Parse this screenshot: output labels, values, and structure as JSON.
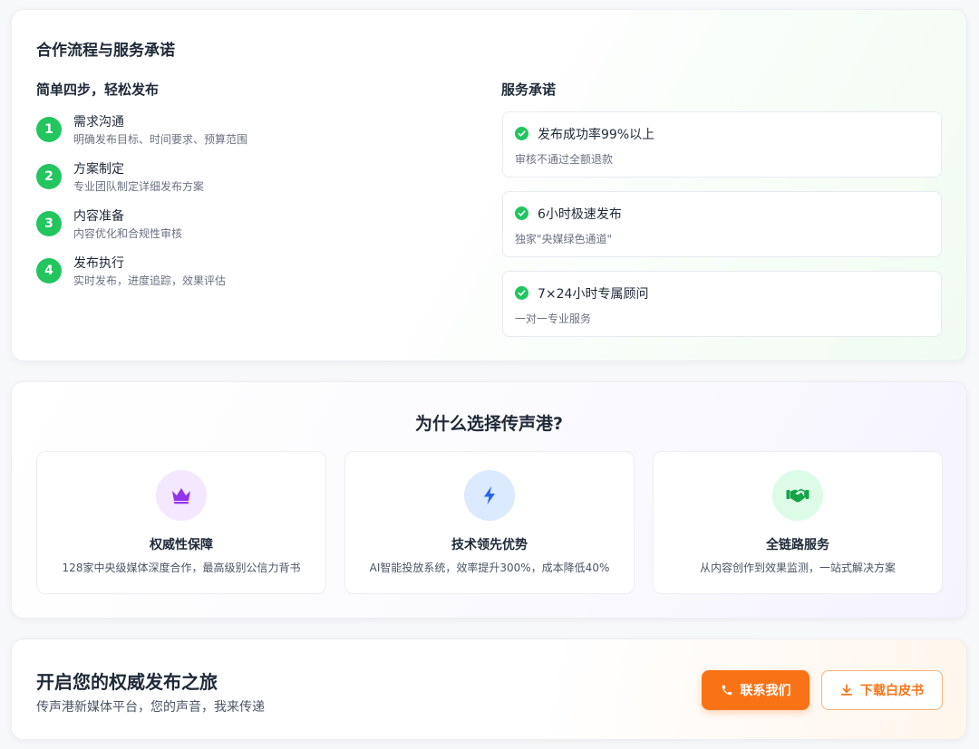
{
  "process": {
    "title": "合作流程与服务承诺",
    "steps_title": "简单四步，轻松发布",
    "steps": [
      {
        "num": "1",
        "title": "需求沟通",
        "desc": "明确发布目标、时间要求、预算范围"
      },
      {
        "num": "2",
        "title": "方案制定",
        "desc": "专业团队制定详细发布方案"
      },
      {
        "num": "3",
        "title": "内容准备",
        "desc": "内容优化和合规性审核"
      },
      {
        "num": "4",
        "title": "发布执行",
        "desc": "实时发布，进度追踪，效果评估"
      }
    ],
    "promise_title": "服务承诺",
    "promises": [
      {
        "title": "发布成功率99%以上",
        "desc": "审核不通过全额退款",
        "icon": "check-circle-icon"
      },
      {
        "title": "6小时极速发布",
        "desc": "独家\"央媒绿色通道\"",
        "icon": "check-circle-icon"
      },
      {
        "title": "7×24小时专属顾问",
        "desc": "一对一专业服务",
        "icon": "check-circle-icon"
      }
    ],
    "colors": {
      "accent": "#22c55e"
    }
  },
  "why": {
    "title": "为什么选择传声港?",
    "features": [
      {
        "title": "权威性保障",
        "desc": "128家中央级媒体深度合作，最高级别公信力背书",
        "icon": "crown-icon",
        "icon_color": "#9333ea",
        "icon_bg": "#f3e8ff"
      },
      {
        "title": "技术领先优势",
        "desc": "AI智能投放系统，效率提升300%，成本降低40%",
        "icon": "lightning-icon",
        "icon_color": "#2563eb",
        "icon_bg": "#dbeafe"
      },
      {
        "title": "全链路服务",
        "desc": "从内容创作到效果监测，一站式解决方案",
        "icon": "handshake-icon",
        "icon_color": "#16a34a",
        "icon_bg": "#dcfce7"
      }
    ]
  },
  "cta": {
    "title": "开启您的权威发布之旅",
    "subtitle": "传声港新媒体平台，您的声音，我来传递",
    "contact_label": "联系我们",
    "download_label": "下载白皮书",
    "colors": {
      "accent": "#f97316"
    }
  }
}
